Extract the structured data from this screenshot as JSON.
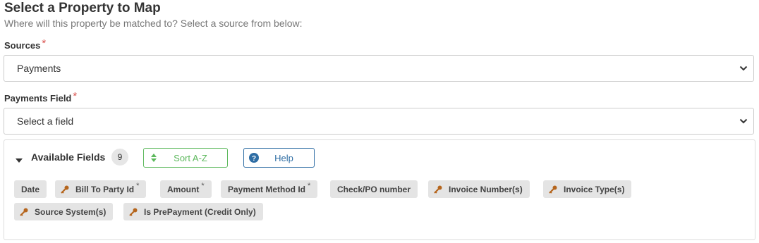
{
  "header": {
    "title": "Select a Property to Map",
    "subtitle": "Where will this property be matched to? Select a source from below:"
  },
  "sources": {
    "label": "Sources",
    "required_mark": "*",
    "value": "Payments"
  },
  "payments_field": {
    "label": "Payments Field",
    "required_mark": "*",
    "placeholder": "Select a field"
  },
  "available_fields": {
    "title": "Available Fields",
    "count": "9",
    "sort_label": "Sort A-Z",
    "help_label": "Help",
    "fields": [
      {
        "label": "Date",
        "key": false,
        "required": false
      },
      {
        "label": "Bill To Party Id",
        "key": true,
        "required": true
      },
      {
        "label": "Amount",
        "key": false,
        "required": true
      },
      {
        "label": "Payment Method Id",
        "key": false,
        "required": true
      },
      {
        "label": "Check/PO number",
        "key": false,
        "required": false
      },
      {
        "label": "Invoice Number(s)",
        "key": true,
        "required": false
      },
      {
        "label": "Invoice Type(s)",
        "key": true,
        "required": false
      },
      {
        "label": "Source System(s)",
        "key": true,
        "required": false
      },
      {
        "label": "Is PrePayment (Credit Only)",
        "key": true,
        "required": false
      }
    ]
  },
  "colors": {
    "sort_green": "#5cb85c",
    "help_blue": "#2e6da4",
    "key_icon": "#b5651d",
    "required_red": "#d9534f"
  },
  "icons": {
    "sort": "sort-arrows-icon",
    "help": "question-circle-icon",
    "key": "key-icon",
    "caret": "caret-down-icon",
    "chevron": "chevron-down-icon"
  }
}
